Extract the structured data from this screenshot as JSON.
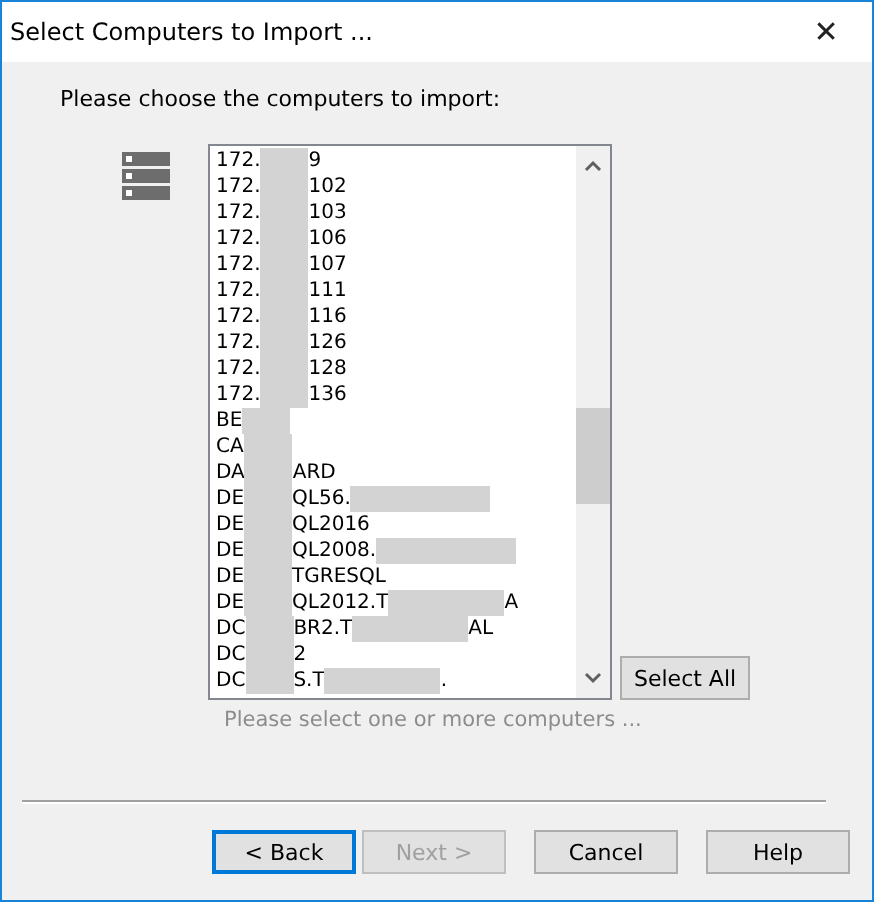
{
  "window": {
    "title": "Select Computers to Import ...",
    "close": "✕"
  },
  "prompt": "Please choose the computers to import:",
  "computers": [
    {
      "segments": [
        "172.",
        "9"
      ]
    },
    {
      "segments": [
        "172.",
        "102"
      ]
    },
    {
      "segments": [
        "172.",
        "103"
      ]
    },
    {
      "segments": [
        "172.",
        "106"
      ]
    },
    {
      "segments": [
        "172.",
        "107"
      ]
    },
    {
      "segments": [
        "172.",
        "111"
      ]
    },
    {
      "segments": [
        "172.",
        "116"
      ]
    },
    {
      "segments": [
        "172.",
        "126"
      ]
    },
    {
      "segments": [
        "172.",
        "128"
      ]
    },
    {
      "segments": [
        "172.",
        "136"
      ]
    },
    {
      "segments": [
        "BE"
      ]
    },
    {
      "segments": [
        "CA"
      ]
    },
    {
      "segments": [
        "DA",
        "ARD"
      ]
    },
    {
      "segments": [
        "DE",
        "QL56."
      ],
      "tail_redacted": true
    },
    {
      "segments": [
        "DE",
        "QL2016"
      ]
    },
    {
      "segments": [
        "DE",
        "QL2008."
      ],
      "tail_redacted": true
    },
    {
      "segments": [
        "DE",
        "TGRESQL"
      ]
    },
    {
      "segments": [
        "DE",
        "QL2012.T",
        "A"
      ]
    },
    {
      "segments": [
        "DC",
        "BR2.T",
        "AL"
      ]
    },
    {
      "segments": [
        "DC",
        "2"
      ]
    },
    {
      "segments": [
        "DC",
        "S.T",
        "."
      ]
    }
  ],
  "select_all": "Select All",
  "hint": "Please select one or more computers ...",
  "buttons": [
    {
      "label": "< Back",
      "disabled": false,
      "focused": true
    },
    {
      "label": "Next >",
      "disabled": true,
      "focused": false
    },
    {
      "label": "Cancel",
      "disabled": false,
      "focused": false
    },
    {
      "label": "Help",
      "disabled": false,
      "focused": false
    }
  ]
}
